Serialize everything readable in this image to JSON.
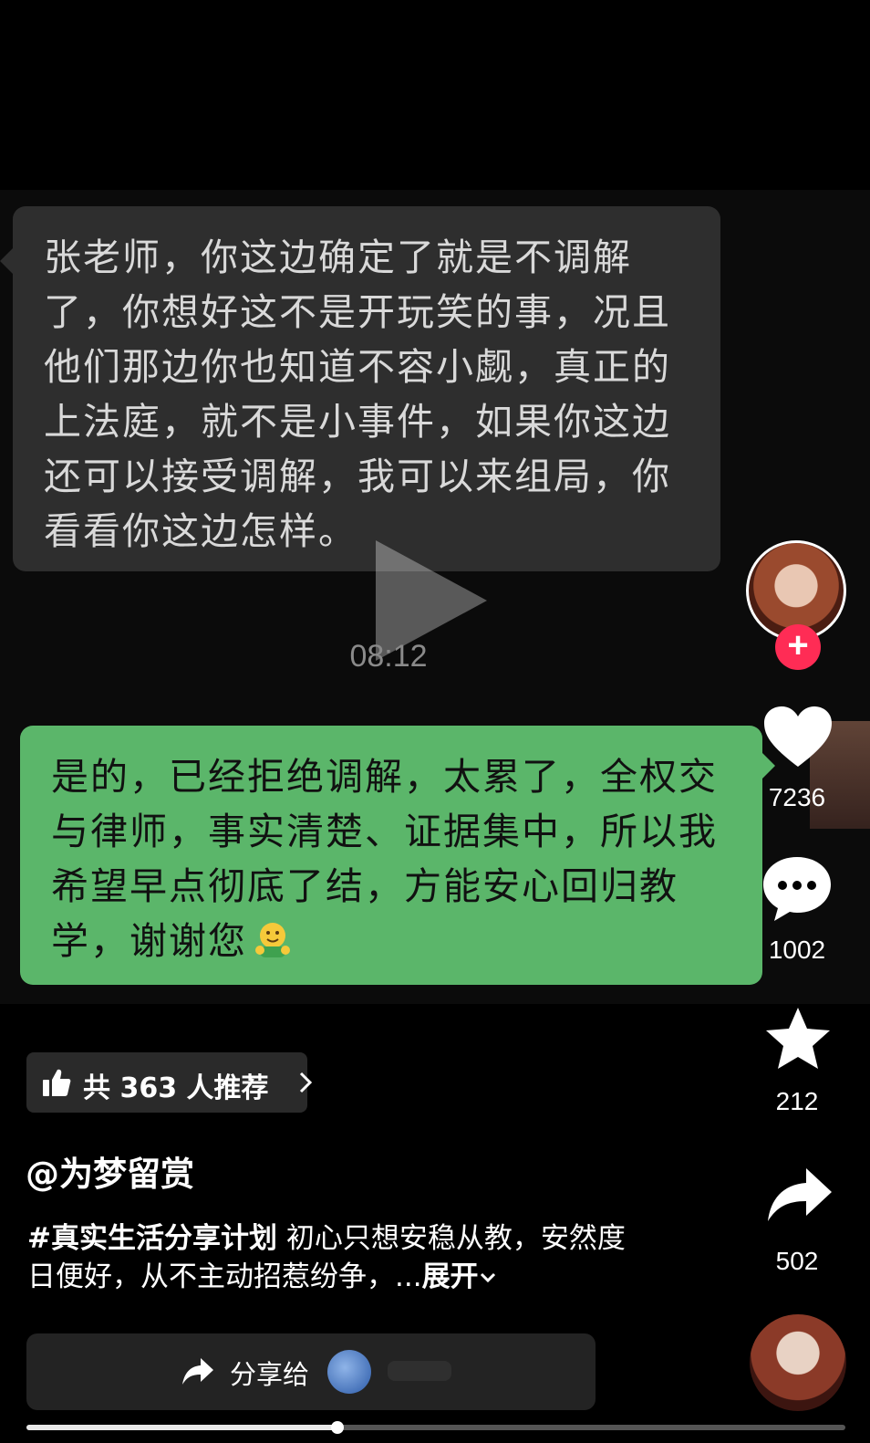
{
  "chat": {
    "received_message": "张老师，你这边确定了就是不调解了，你想好这不是开玩笑的事，况且他们那边你也知道不容小觑，真正的上法庭，就不是小事件，如果你这边还可以接受调解，我可以来组局，你看看你这边怎样。",
    "sent_message": "是的，已经拒绝调解，太累了，全权交与律师，事实清楚、证据集中，所以我希望早点彻底了结，方能安心回归教学，谢谢您",
    "sent_emoji": "hugging-face-emoji"
  },
  "video": {
    "duration": "08:12",
    "progress_fraction": 0.38
  },
  "actions": {
    "follow_label": "+",
    "likes": "7236",
    "comments": "1002",
    "favorites": "212",
    "shares": "502"
  },
  "recommend": {
    "label": "共 363 人推荐"
  },
  "author": "@为梦留赏",
  "description": {
    "hashtag": "#真实生活分享计划",
    "text": " 初心只想安稳从教，安然度日便好，从不主动招惹纷争，...",
    "expand": "展开"
  },
  "share": {
    "label": "分享给"
  },
  "colors": {
    "sent_bubble": "#5bb66a",
    "received_bubble": "#2e2e2e",
    "follow": "#ff2c55"
  }
}
